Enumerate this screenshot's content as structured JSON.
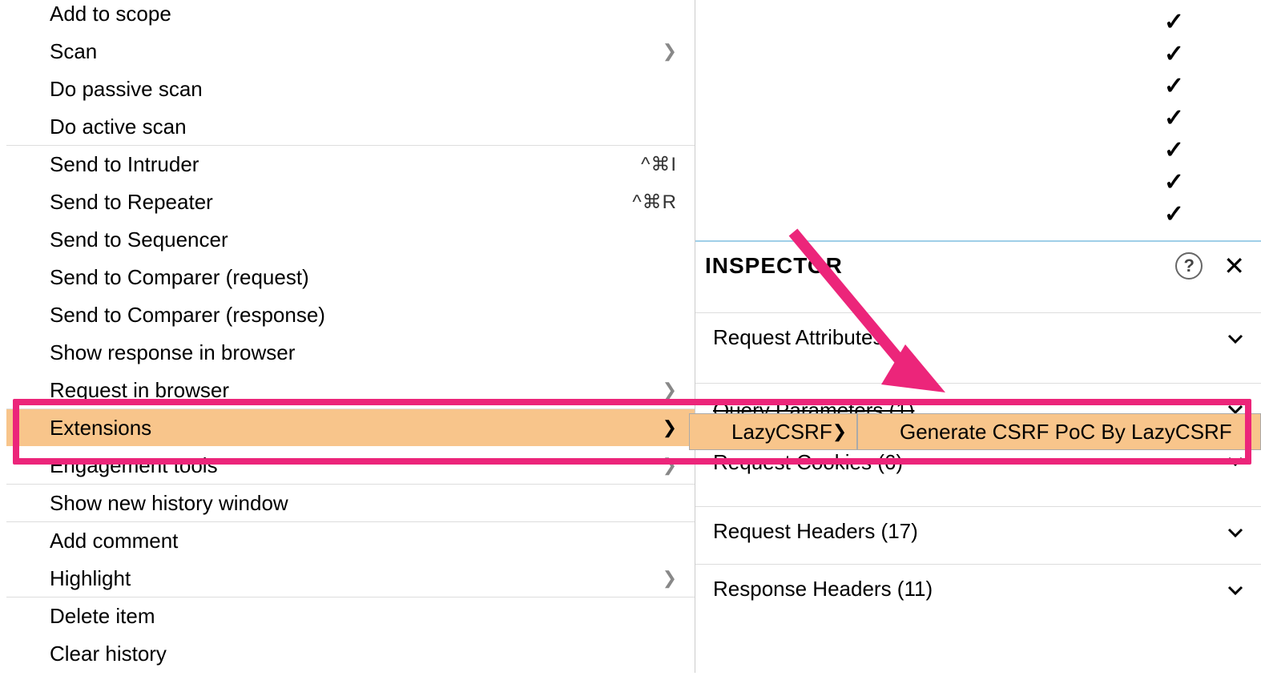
{
  "menu": {
    "add_to_scope": "Add to scope",
    "scan": "Scan",
    "do_passive_scan": "Do passive scan",
    "do_active_scan": "Do active scan",
    "send_to_intruder": "Send to Intruder",
    "send_to_intruder_shortcut": "^⌘I",
    "send_to_repeater": "Send to Repeater",
    "send_to_repeater_shortcut": "^⌘R",
    "send_to_sequencer": "Send to Sequencer",
    "send_to_comparer_req": "Send to Comparer (request)",
    "send_to_comparer_resp": "Send to Comparer (response)",
    "show_response_in_browser": "Show response in browser",
    "request_in_browser": "Request in browser",
    "extensions": "Extensions",
    "engagement_tools": "Engagement tools",
    "show_new_history_window": "Show new history window",
    "add_comment": "Add comment",
    "highlight": "Highlight",
    "delete_item": "Delete item",
    "clear_history": "Clear history"
  },
  "submenu": {
    "lazycsrf": "LazyCSRF",
    "generate": "Generate CSRF PoC By LazyCSRF"
  },
  "inspector": {
    "title": "INSPECTOR",
    "request_attributes": "Request Attributes",
    "query_parameters": "Query Parameters (1)",
    "request_cookies": "Request Cookies (6)",
    "request_headers": "Request Headers (17)",
    "response_headers": "Response Headers (11)"
  },
  "glyphs": {
    "chevron_right": "❯",
    "chevron_down": "⌄",
    "check": "✓",
    "help": "?",
    "close": "✕"
  }
}
